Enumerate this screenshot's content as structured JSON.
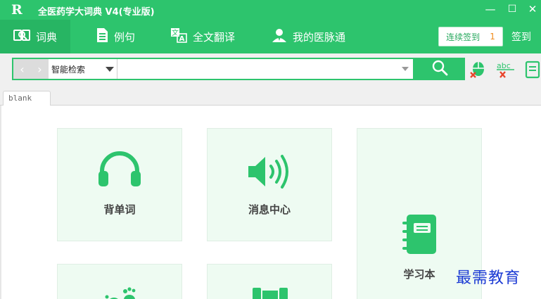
{
  "window": {
    "logo_text": "R",
    "title": "全医药学大词典 V4(专业版)",
    "minimize_glyph": "—",
    "maximize_glyph": "☐",
    "close_glyph": "✕"
  },
  "nav": {
    "tabs": [
      {
        "label": "词典",
        "icon": "dictionary-icon"
      },
      {
        "label": "例句",
        "icon": "document-icon"
      },
      {
        "label": "全文翻译",
        "icon": "translate-icon"
      },
      {
        "label": "我的医脉通",
        "icon": "user-icon"
      }
    ],
    "active_tab": "词典",
    "checkin": {
      "label": "连续签到",
      "count": "1",
      "button": "签到"
    }
  },
  "search": {
    "back_glyph": "‹",
    "forward_glyph": "›",
    "mode": "智能检索",
    "query": "",
    "tools": [
      "mouse-translate-icon",
      "spellcheck-icon",
      "notes-icon"
    ]
  },
  "tabs": [
    {
      "label": "blank"
    }
  ],
  "cards": [
    {
      "label": "背单词",
      "icon": "headphones-icon"
    },
    {
      "label": "消息中心",
      "icon": "speaker-icon"
    },
    {
      "label": "学习本",
      "icon": "notebook-icon"
    },
    {
      "label": "",
      "icon": "footprints-icon"
    },
    {
      "label": "",
      "icon": "book-icon"
    }
  ],
  "watermark": "最需教育",
  "colors": {
    "brand": "#2dc46d",
    "card_bg": "#eefbf2",
    "checkin_count": "#f08a1a"
  }
}
